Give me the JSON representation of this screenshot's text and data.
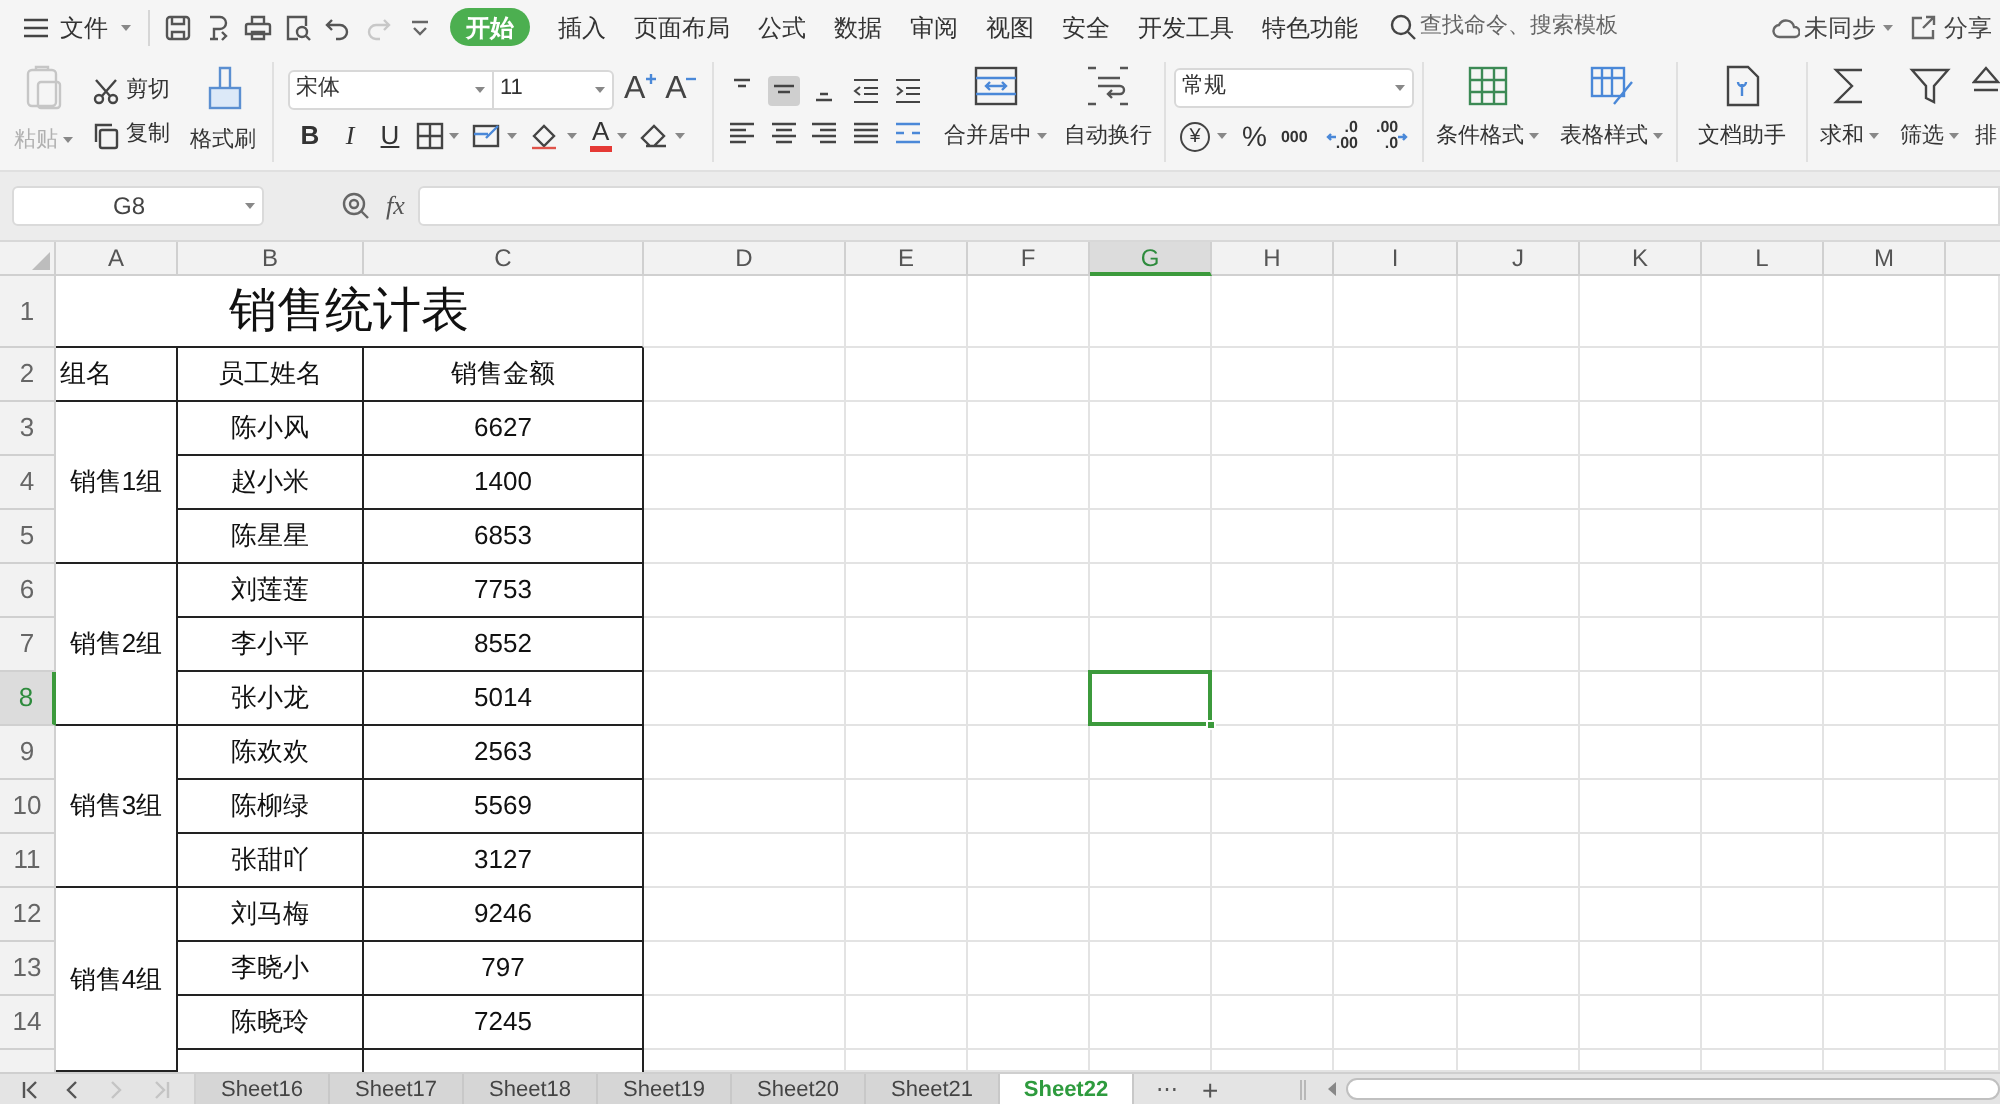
{
  "menu_bar": {
    "file_menu": "文件",
    "quick_access": [
      {
        "kind": "save",
        "disabled": false
      },
      {
        "kind": "export",
        "disabled": false
      },
      {
        "kind": "print",
        "disabled": false
      },
      {
        "kind": "preview",
        "disabled": false
      },
      {
        "kind": "undo",
        "disabled": false
      },
      {
        "kind": "redo",
        "disabled": true
      }
    ],
    "tabs": [
      {
        "label": "开始",
        "selected": true
      },
      {
        "label": "插入",
        "selected": false
      },
      {
        "label": "页面布局",
        "selected": false
      },
      {
        "label": "公式",
        "selected": false
      },
      {
        "label": "数据",
        "selected": false
      },
      {
        "label": "审阅",
        "selected": false
      },
      {
        "label": "视图",
        "selected": false
      },
      {
        "label": "安全",
        "selected": false
      },
      {
        "label": "开发工具",
        "selected": false
      },
      {
        "label": "特色功能",
        "selected": false
      }
    ],
    "search": {
      "placeholder": "查找命令、搜索模板"
    },
    "sync": "未同步",
    "share": "分享"
  },
  "ribbon": {
    "paste": {
      "label": "粘贴",
      "disabled": true
    },
    "cut": "剪切",
    "copy": "复制",
    "format_painter": "格式刷",
    "font": "宋体",
    "font_size": "11",
    "font_size_buttons": [
      {
        "kind": "grow",
        "label": "A"
      },
      {
        "kind": "shrink",
        "label": "A"
      }
    ],
    "style_buttons": [
      {
        "kind": "bold",
        "label": "B"
      },
      {
        "kind": "italic",
        "label": "I"
      },
      {
        "kind": "underline",
        "label": "U"
      }
    ],
    "font_color": "A",
    "merge_center": "合并居中",
    "wrap_text": "自动换行",
    "number_format": "常规",
    "currency": "¥",
    "percent": "%",
    "thousands": "000",
    "decimal_buttons": [
      {
        "kind": "increase",
        "top": ".0",
        "bottom": ".00"
      },
      {
        "kind": "decrease",
        "top": ".00",
        "bottom": ".0"
      }
    ],
    "conditional_format": "条件格式",
    "table_style": "表格样式",
    "doc_assistant": "文档助手",
    "sum": "求和",
    "filter": "筛选",
    "sort": "排"
  },
  "formula_bar": {
    "name_box": "G8",
    "fx": "fx"
  },
  "sheet": {
    "columns": [
      {
        "label": "A",
        "selected": false
      },
      {
        "label": "B",
        "selected": false
      },
      {
        "label": "C",
        "selected": false
      },
      {
        "label": "D",
        "selected": false
      },
      {
        "label": "E",
        "selected": false
      },
      {
        "label": "F",
        "selected": false
      },
      {
        "label": "G",
        "selected": true
      },
      {
        "label": "H",
        "selected": false
      },
      {
        "label": "I",
        "selected": false
      },
      {
        "label": "J",
        "selected": false
      },
      {
        "label": "K",
        "selected": false
      },
      {
        "label": "L",
        "selected": false
      },
      {
        "label": "M",
        "selected": false
      }
    ],
    "rows": [
      {
        "label": "1",
        "selected": false
      },
      {
        "label": "2",
        "selected": false
      },
      {
        "label": "3",
        "selected": false
      },
      {
        "label": "4",
        "selected": false
      },
      {
        "label": "5",
        "selected": false
      },
      {
        "label": "6",
        "selected": false
      },
      {
        "label": "7",
        "selected": false
      },
      {
        "label": "8",
        "selected": true
      },
      {
        "label": "9",
        "selected": false
      },
      {
        "label": "10",
        "selected": false
      },
      {
        "label": "11",
        "selected": false
      },
      {
        "label": "12",
        "selected": false
      },
      {
        "label": "13",
        "selected": false
      },
      {
        "label": "14",
        "selected": false
      }
    ],
    "title": "销售统计表",
    "headers": [
      "组名",
      "员工姓名",
      "销售金额"
    ],
    "groups": [
      {
        "name": "销售1组",
        "continues_below": false,
        "members": [
          {
            "name": "陈小风",
            "amount": "6627"
          },
          {
            "name": "赵小米",
            "amount": "1400"
          },
          {
            "name": "陈星星",
            "amount": "6853"
          }
        ]
      },
      {
        "name": "销售2组",
        "continues_below": false,
        "members": [
          {
            "name": "刘莲莲",
            "amount": "7753"
          },
          {
            "name": "李小平",
            "amount": "8552"
          },
          {
            "name": "张小龙",
            "amount": "5014"
          }
        ]
      },
      {
        "name": "销售3组",
        "continues_below": false,
        "members": [
          {
            "name": "陈欢欢",
            "amount": "2563"
          },
          {
            "name": "陈柳绿",
            "amount": "5569"
          },
          {
            "name": "张甜吖",
            "amount": "3127"
          }
        ]
      },
      {
        "name": "销售4组",
        "continues_below": true,
        "members": [
          {
            "name": "刘马梅",
            "amount": "9246"
          },
          {
            "name": "李晓小",
            "amount": "797"
          },
          {
            "name": "陈晓玲",
            "amount": "7245"
          }
        ]
      }
    ]
  },
  "sheet_tabs": {
    "nav_buttons": [
      {
        "kind": "first",
        "disabled": false
      },
      {
        "kind": "prev",
        "disabled": false
      },
      {
        "kind": "next",
        "disabled": true
      },
      {
        "kind": "last",
        "disabled": true
      }
    ],
    "tabs": [
      {
        "label": "Sheet16",
        "selected": false
      },
      {
        "label": "Sheet17",
        "selected": false
      },
      {
        "label": "Sheet18",
        "selected": false
      },
      {
        "label": "Sheet19",
        "selected": false
      },
      {
        "label": "Sheet20",
        "selected": false
      },
      {
        "label": "Sheet21",
        "selected": false
      },
      {
        "label": "Sheet22",
        "selected": true
      }
    ],
    "more": "⋯",
    "add": "+"
  }
}
